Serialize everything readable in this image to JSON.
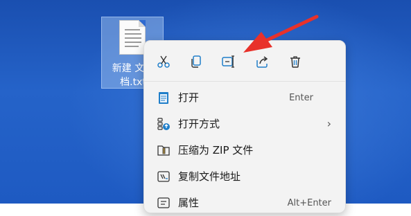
{
  "file": {
    "name": "新建 文本\n档.txt",
    "icon": "text-document-icon"
  },
  "toolbar": {
    "icons": [
      "cut-icon",
      "copy-icon",
      "rename-icon",
      "share-icon",
      "delete-icon"
    ],
    "accent": "#1f7ec9"
  },
  "menu": {
    "items": [
      {
        "label": "打开",
        "shortcut": "Enter",
        "icon": "notepad-icon"
      },
      {
        "label": "打开方式",
        "shortcut": "",
        "icon": "open-with-icon",
        "submenu": "›"
      },
      {
        "label": "压缩为 ZIP 文件",
        "shortcut": "",
        "icon": "zip-folder-icon"
      },
      {
        "label": "复制文件地址",
        "shortcut": "",
        "icon": "copy-path-icon"
      },
      {
        "label": "属性",
        "shortcut": "Alt+Enter",
        "icon": "properties-icon"
      }
    ]
  },
  "annotation": {
    "color": "#e8312a",
    "icon": "red-arrow-icon"
  }
}
